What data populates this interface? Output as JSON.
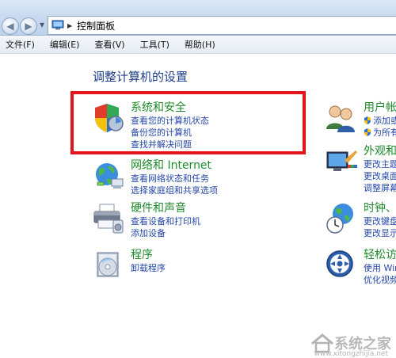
{
  "address_bar": {
    "breadcrumb": "控制面板"
  },
  "menu": [
    {
      "label": "文件(F)"
    },
    {
      "label": "编辑(E)"
    },
    {
      "label": "查看(V)"
    },
    {
      "label": "工具(T)"
    },
    {
      "label": "帮助(H)"
    }
  ],
  "content": {
    "title": "调整计算机的设置",
    "left_categories": [
      {
        "title": "系统和安全",
        "icon": "shield-icon",
        "links": [
          "查看您的计算机状态",
          "备份您的计算机",
          "查找并解决问题"
        ]
      },
      {
        "title": "网络和 Internet",
        "icon": "network-globe-icon",
        "links": [
          "查看网络状态和任务",
          "选择家庭组和共享选项"
        ]
      },
      {
        "title": "硬件和声音",
        "icon": "printer-icon",
        "links": [
          "查看设备和打印机",
          "添加设备"
        ]
      },
      {
        "title": "程序",
        "icon": "programs-icon",
        "links": [
          "卸载程序"
        ]
      }
    ],
    "right_categories": [
      {
        "title": "用户帐",
        "icon": "users-icon",
        "links": [
          "添加或",
          "为所有"
        ]
      },
      {
        "title": "外观和",
        "icon": "appearance-icon",
        "links": [
          "更改主题",
          "更改桌面",
          "调整屏幕"
        ]
      },
      {
        "title": "时钟、",
        "icon": "clock-globe-icon",
        "links": [
          "更改键盘",
          "更改显示"
        ]
      },
      {
        "title": "轻松访",
        "icon": "ease-of-access-icon",
        "links": [
          "使用 Win",
          "优化视频"
        ]
      }
    ]
  },
  "highlight_color": "#e4141d",
  "watermark": {
    "text": "系统之家",
    "url": "www.xitongzhijia.net"
  }
}
